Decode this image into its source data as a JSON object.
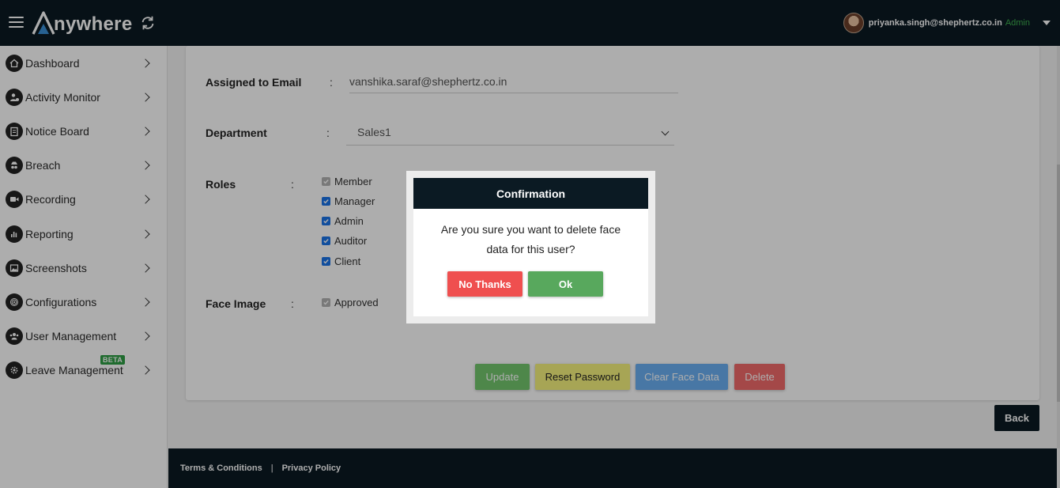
{
  "header": {
    "brand": "nywhere",
    "user_email": "priyanka.singh@shephertz.co.in",
    "user_role": "Admin"
  },
  "sidebar": {
    "items": [
      {
        "label": "Dashboard",
        "icon": "home-icon"
      },
      {
        "label": "Activity Monitor",
        "icon": "user-activity-icon"
      },
      {
        "label": "Notice Board",
        "icon": "clipboard-icon"
      },
      {
        "label": "Breach",
        "icon": "incognito-icon"
      },
      {
        "label": "Recording",
        "icon": "video-camera-icon"
      },
      {
        "label": "Reporting",
        "icon": "bar-chart-icon"
      },
      {
        "label": "Screenshots",
        "icon": "image-icon"
      },
      {
        "label": "Configurations",
        "icon": "fingerprint-icon"
      },
      {
        "label": "User Management",
        "icon": "users-icon"
      },
      {
        "label": "Leave Management",
        "icon": "gear-icon",
        "badge": "BETA"
      }
    ]
  },
  "form": {
    "email_label": "Assigned to Email",
    "email_value": "vanshika.saraf@shephertz.co.in",
    "department_label": "Department",
    "department_value": "Sales1",
    "roles_label": "Roles",
    "roles": [
      {
        "label": "Member",
        "state": "disabled-checked"
      },
      {
        "label": "Manager",
        "state": "checked"
      },
      {
        "label": "Admin",
        "state": "checked"
      },
      {
        "label": "Auditor",
        "state": "checked"
      },
      {
        "label": "Client",
        "state": "checked"
      }
    ],
    "face_label": "Face Image",
    "face_status": "Approved",
    "colon": ":"
  },
  "actions": {
    "update": "Update",
    "reset_password": "Reset Password",
    "clear_face_data": "Clear Face Data",
    "delete": "Delete",
    "back": "Back"
  },
  "footer": {
    "terms": "Terms & Conditions",
    "separator": "|",
    "privacy": "Privacy Policy"
  },
  "dialog": {
    "title": "Confirmation",
    "message": "Are you sure you want to delete face data for this user?",
    "no_label": "No Thanks",
    "ok_label": "Ok"
  },
  "colors": {
    "navy": "#0b1a23",
    "admin_green": "#3fb24f",
    "ok_green": "#58a85d",
    "no_red": "#ef4f4f"
  }
}
